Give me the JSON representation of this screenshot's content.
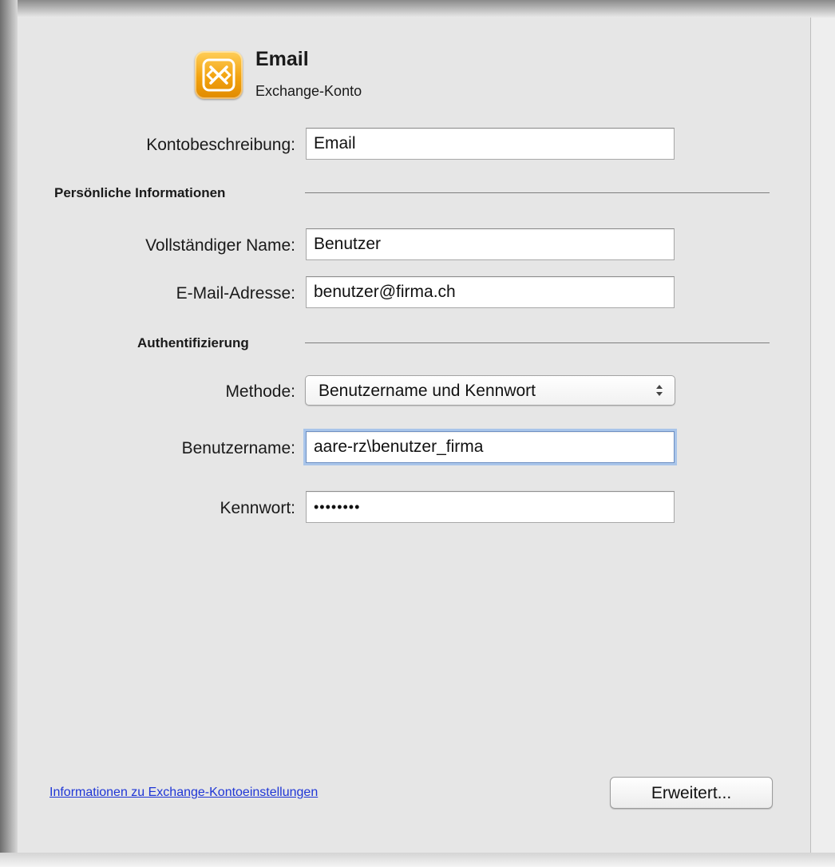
{
  "header": {
    "title": "Email",
    "subtitle": "Exchange-Konto",
    "icon": "exchange-icon"
  },
  "account": {
    "description_label": "Kontobeschreibung:",
    "description_value": "Email"
  },
  "personal": {
    "section_title": "Persönliche Informationen",
    "full_name_label": "Vollständiger Name:",
    "full_name_value": "Benutzer",
    "email_label": "E-Mail-Adresse:",
    "email_value": "benutzer@firma.ch"
  },
  "auth": {
    "section_title": "Authentifizierung",
    "method_label": "Methode:",
    "method_value": "Benutzername und Kennwort",
    "username_label": "Benutzername:",
    "username_value": "aare-rz\\benutzer_firma",
    "password_label": "Kennwort:",
    "password_value": "••••••••"
  },
  "footer": {
    "info_link": "Informationen zu Exchange-Kontoeinstellungen",
    "advanced_button": "Erweitert..."
  },
  "colors": {
    "panel_bg": "#e6e6e6",
    "link": "#1f36d6",
    "icon_orange": "#f2a20e",
    "focus_ring": "#a9c5ea"
  }
}
